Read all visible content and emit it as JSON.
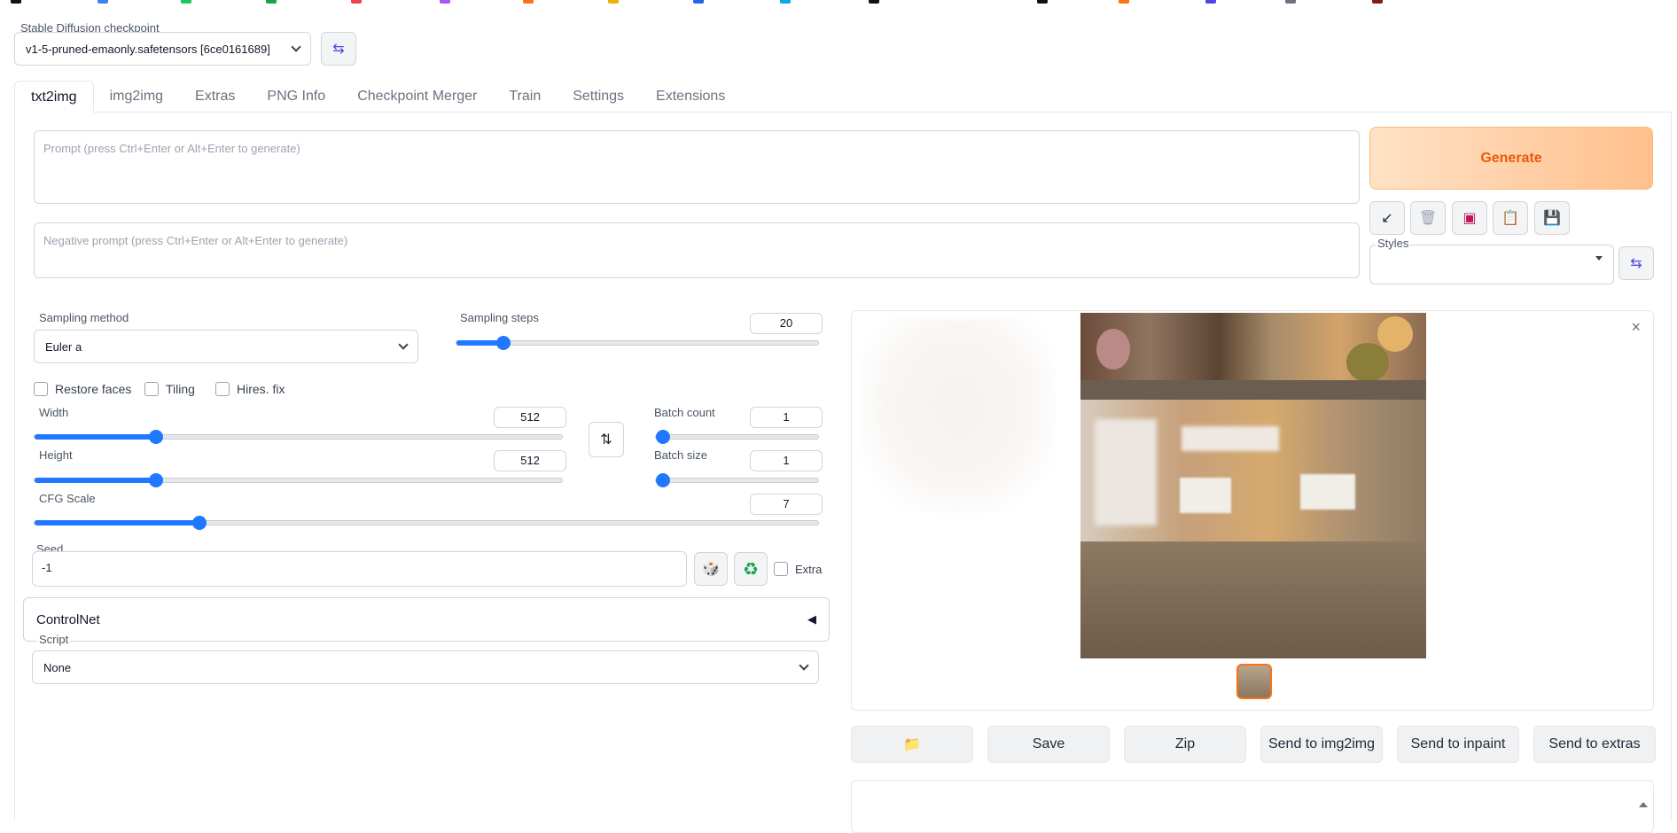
{
  "checkpoint": {
    "label": "Stable Diffusion checkpoint",
    "value": "v1-5-pruned-emaonly.safetensors [6ce0161689]"
  },
  "tabs": [
    {
      "label": "txt2img",
      "active": true
    },
    {
      "label": "img2img"
    },
    {
      "label": "Extras"
    },
    {
      "label": "PNG Info"
    },
    {
      "label": "Checkpoint Merger"
    },
    {
      "label": "Train"
    },
    {
      "label": "Settings"
    },
    {
      "label": "Extensions"
    }
  ],
  "prompt": {
    "placeholder": "Prompt (press Ctrl+Enter or Alt+Enter to generate)"
  },
  "negative_prompt": {
    "placeholder": "Negative prompt (press Ctrl+Enter or Alt+Enter to generate)"
  },
  "generate": {
    "label": "Generate"
  },
  "styles": {
    "label": "Styles",
    "value": ""
  },
  "sampling": {
    "method_label": "Sampling method",
    "method_value": "Euler a",
    "steps_label": "Sampling steps",
    "steps_value": "20",
    "steps_fraction": 0.13
  },
  "options": {
    "restore_faces": "Restore faces",
    "tiling": "Tiling",
    "hires_fix": "Hires. fix"
  },
  "width": {
    "label": "Width",
    "value": "512",
    "fraction": 0.23
  },
  "height": {
    "label": "Height",
    "value": "512",
    "fraction": 0.23
  },
  "batch_count": {
    "label": "Batch count",
    "value": "1",
    "fraction": 0.0
  },
  "batch_size": {
    "label": "Batch size",
    "value": "1",
    "fraction": 0.0
  },
  "cfg": {
    "label": "CFG Scale",
    "value": "7",
    "fraction": 0.21
  },
  "seed": {
    "label": "Seed",
    "value": "-1",
    "extra_label": "Extra"
  },
  "controlnet": {
    "label": "ControlNet",
    "toggle": "◀"
  },
  "script": {
    "label": "Script",
    "value": "None"
  },
  "gallery": {
    "close": "×"
  },
  "actions": {
    "folder": "📁",
    "save": "Save",
    "zip": "Zip",
    "send_img2img": "Send to img2img",
    "send_inpaint": "Send to inpaint",
    "send_extras": "Send to extras"
  },
  "icons": {
    "swap_checkpoint": "⇆",
    "arrow": "↙",
    "trash": "🗑",
    "book": "▣",
    "clipboard": "📋",
    "floppy": "💾",
    "swap_dims": "⇅",
    "dice": "🎲",
    "recycle": "♻"
  }
}
